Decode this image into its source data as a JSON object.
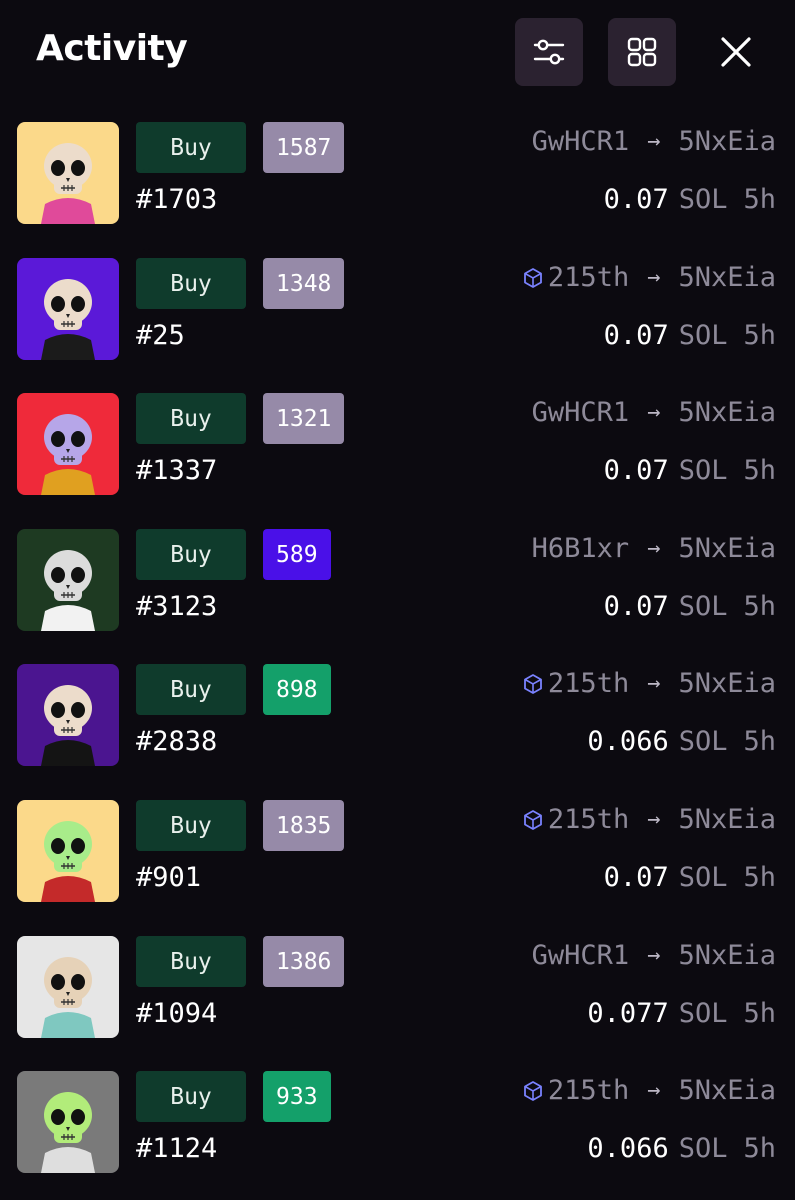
{
  "header": {
    "title": "Activity"
  },
  "rows": [
    {
      "action": "Buy",
      "rank": "1587",
      "rank_style": "gray",
      "token": "#1703",
      "from": "GwHCR1",
      "from_verified": false,
      "to": "5NxEia",
      "price": "0.07",
      "currency": "SOL",
      "age": "5h",
      "thumb": {
        "bg": "#fbd98a",
        "skull": "#ecdccb",
        "body": "#e04a9a"
      }
    },
    {
      "action": "Buy",
      "rank": "1348",
      "rank_style": "gray",
      "token": "#25",
      "from": "215th",
      "from_verified": true,
      "to": "5NxEia",
      "price": "0.07",
      "currency": "SOL",
      "age": "5h",
      "thumb": {
        "bg": "#5b19d8",
        "skull": "#ecdccb",
        "body": "#1b1b1b"
      }
    },
    {
      "action": "Buy",
      "rank": "1321",
      "rank_style": "gray",
      "token": "#1337",
      "from": "GwHCR1",
      "from_verified": false,
      "to": "5NxEia",
      "price": "0.07",
      "currency": "SOL",
      "age": "5h",
      "thumb": {
        "bg": "#ef2a3a",
        "skull": "#b6a6e8",
        "body": "#e0a020"
      }
    },
    {
      "action": "Buy",
      "rank": "589",
      "rank_style": "purple",
      "token": "#3123",
      "from": "H6B1xr",
      "from_verified": false,
      "to": "5NxEia",
      "price": "0.07",
      "currency": "SOL",
      "age": "5h",
      "thumb": {
        "bg": "#1e3a22",
        "skull": "#dcdcdc",
        "body": "#f2f2f2"
      }
    },
    {
      "action": "Buy",
      "rank": "898",
      "rank_style": "green",
      "token": "#2838",
      "from": "215th",
      "from_verified": true,
      "to": "5NxEia",
      "price": "0.066",
      "currency": "SOL",
      "age": "5h",
      "thumb": {
        "bg": "#4b1590",
        "skull": "#ecdccb",
        "body": "#141414"
      }
    },
    {
      "action": "Buy",
      "rank": "1835",
      "rank_style": "gray",
      "token": "#901",
      "from": "215th",
      "from_verified": true,
      "to": "5NxEia",
      "price": "0.07",
      "currency": "SOL",
      "age": "5h",
      "thumb": {
        "bg": "#fbd98a",
        "skull": "#a8ec8a",
        "body": "#c42a2a"
      }
    },
    {
      "action": "Buy",
      "rank": "1386",
      "rank_style": "gray",
      "token": "#1094",
      "from": "GwHCR1",
      "from_verified": false,
      "to": "5NxEia",
      "price": "0.077",
      "currency": "SOL",
      "age": "5h",
      "thumb": {
        "bg": "#e6e6e6",
        "skull": "#e6d2b8",
        "body": "#7fc8c0"
      }
    },
    {
      "action": "Buy",
      "rank": "933",
      "rank_style": "green",
      "token": "#1124",
      "from": "215th",
      "from_verified": true,
      "to": "5NxEia",
      "price": "0.066",
      "currency": "SOL",
      "age": "5h",
      "thumb": {
        "bg": "#7a7a7a",
        "skull": "#b2ec7a",
        "body": "#dedede"
      }
    }
  ],
  "colors": {
    "background": "#0c0a10",
    "buy_bg": "#0f3b2c",
    "rank_gray": "#968aa8",
    "rank_purple": "#4a10e8",
    "rank_green": "#14a06a",
    "muted_text": "#8e8a99",
    "verified_icon": "#7a82ff"
  },
  "icons": {
    "filter": "sliders-icon",
    "grid": "grid-view-icon",
    "close": "close-icon",
    "verified": "cube-verified-icon",
    "arrow": "arrow-right-icon"
  }
}
